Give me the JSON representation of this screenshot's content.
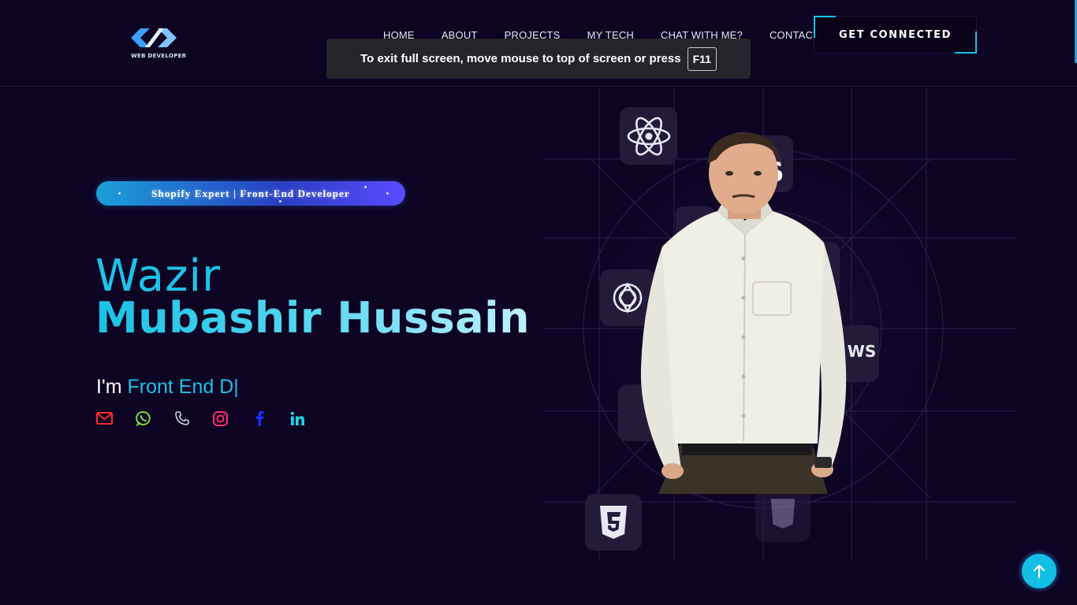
{
  "header": {
    "logo_text": "WEB DEVELOPER",
    "nav": [
      {
        "label": "HOME",
        "active": true
      },
      {
        "label": "ABOUT"
      },
      {
        "label": "PROJECTS"
      },
      {
        "label": "MY TECH"
      },
      {
        "label": "CHAT WITH ME?"
      },
      {
        "label": "CONTACT"
      }
    ],
    "cta_label": "GET CONNECTED"
  },
  "fullscreen_notice": {
    "text": "To exit full screen, move mouse to top of screen or press",
    "key": "F11"
  },
  "hero": {
    "badge": "Shopify Expert | Front-End Developer",
    "first_name": "Wazir",
    "last_name": "Mubashir Hussain",
    "typing_prefix": "I'm",
    "typing_text": "Front End D|",
    "socials": [
      {
        "icon": "mail-icon",
        "color": "#ff2a2a"
      },
      {
        "icon": "whatsapp-icon",
        "color": "#7bdc3a"
      },
      {
        "icon": "phone-icon",
        "color": "#c8d4e6"
      },
      {
        "icon": "instagram-icon",
        "color": "#ff2d6a"
      },
      {
        "icon": "facebook-icon",
        "color": "#1a2dff"
      },
      {
        "icon": "linkedin-icon",
        "color": "#19d4ea"
      }
    ],
    "tech_tiles": [
      "react-icon",
      "javascript-icon",
      "openai-icon",
      "aws-icon",
      "css3-icon",
      "html5-icon"
    ],
    "tile_labels": {
      "js": "JS",
      "aws": "WS"
    }
  },
  "colors": {
    "background": "#0d0322",
    "accent": "#19c2e6"
  }
}
